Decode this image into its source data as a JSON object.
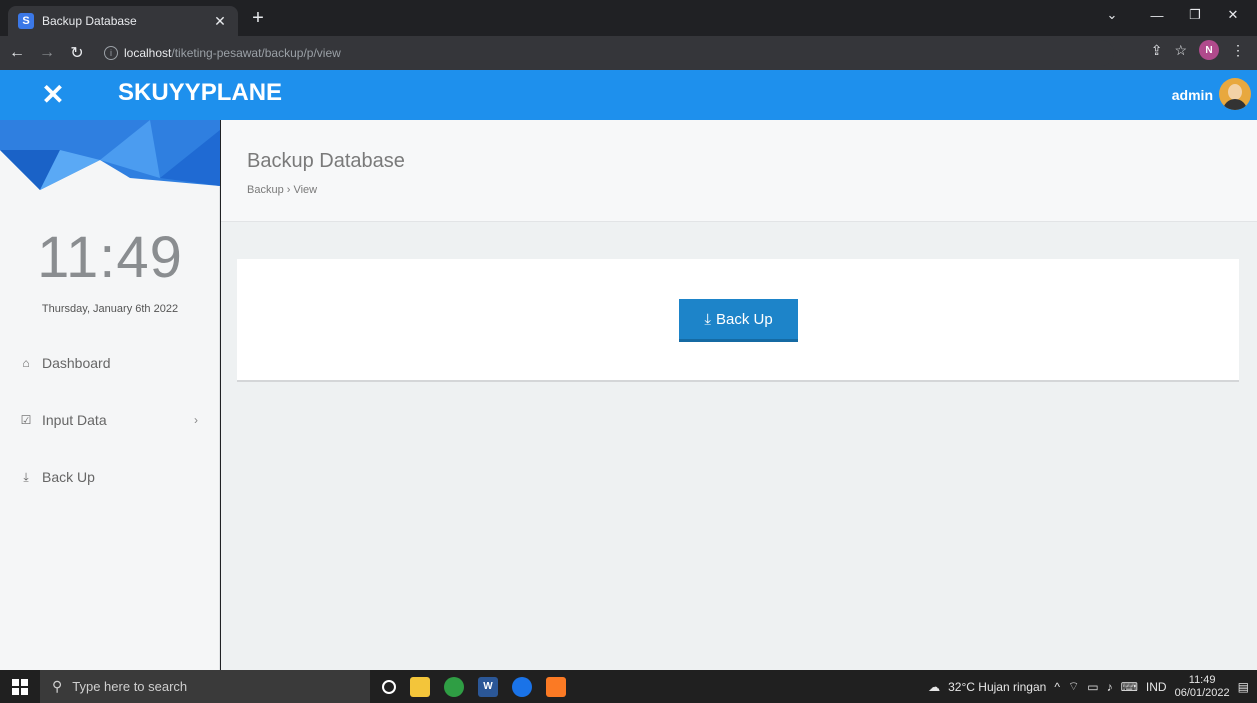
{
  "browser": {
    "tab_title": "Backup Database",
    "url_host": "localhost",
    "url_path": "/tiketing-pesawat/backup/p/view",
    "profile_initial": "N"
  },
  "header": {
    "brand": "SKUYYPLANE",
    "user": "admin"
  },
  "sidebar": {
    "clock": "11:49",
    "date": "Thursday, January 6th 2022",
    "items": [
      {
        "label": "Dashboard",
        "icon": "home-icon"
      },
      {
        "label": "Input Data",
        "icon": "check-square-icon"
      },
      {
        "label": "Back Up",
        "icon": "download-icon"
      }
    ]
  },
  "main": {
    "title": "Backup Database",
    "breadcrumb": "Backup › View",
    "backup_button": "Back Up"
  },
  "taskbar": {
    "search_placeholder": "Type here to search",
    "weather": "32°C  Hujan ringan",
    "lang": "IND",
    "time": "11:49",
    "date": "06/01/2022"
  },
  "colors": {
    "accent": "#1e90ed",
    "button": "#1d84c9"
  }
}
